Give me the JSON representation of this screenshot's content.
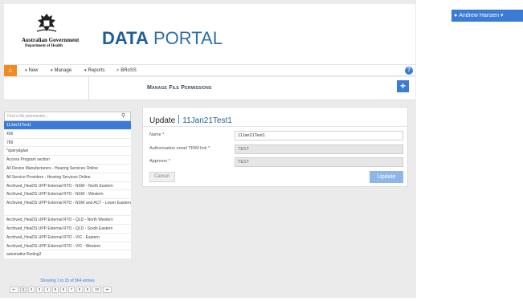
{
  "user": {
    "name": "Andrew Hansen",
    "icon": "user-icon",
    "caret": "▾"
  },
  "logo": {
    "gov_name": "Australian Government",
    "department": "Department of Health",
    "crest_icon": "coat-of-arms-icon"
  },
  "brand": {
    "part1": "DATA",
    "part2": "PORTAL"
  },
  "nav": {
    "home_icon": "home-icon",
    "items": [
      {
        "label": "New",
        "caret": "▾"
      },
      {
        "label": "Manage",
        "caret": "▾"
      },
      {
        "label": "Reports",
        "caret": "▾"
      },
      {
        "label": "BRoSS",
        "icon": "external-link-icon"
      }
    ],
    "help_icon": "question-circle-icon"
  },
  "subheader": {
    "title": "Manage File Permissions",
    "add_icon": "plus-icon"
  },
  "search": {
    "placeholder": "Find a file permission...",
    "icon": "search-icon"
  },
  "list": {
    "items": [
      "11Jan21Test1",
      "456",
      "789",
      "*query&glue",
      "Access Program section",
      "All Device Manufacturers - Hearing Services Online",
      "All Service Providers - Hearing Services Online",
      "Archived_HeaDS UPP External RTO - NSW - North Eastern",
      "Archived_HeaDS UPP External RTO - NSW - Western",
      "Archived_HeaDS UPP External RTO - NSW and ACT - Lower Eastern",
      "Archived_HeaDS UPP External RTO - QLD - North Western",
      "Archived_HeaDS UPP External RTO - QLD - South Eastern",
      "Archived_HeaDS UPP External RTO - VIC - Eastern",
      "Archived_HeaDS UPP External RTO - VIC - Western",
      "automationTesting2"
    ],
    "selected_index": 0
  },
  "pagination": {
    "info": "Showing 1 to 15 of 564 entries",
    "first": "⇤",
    "pages": [
      "1",
      "2",
      "3",
      "4",
      "5",
      "6",
      "7",
      "8",
      "9",
      "10"
    ],
    "next": "↦",
    "current": "1"
  },
  "form": {
    "heading": "Update",
    "record_name": "11Jan21Test1",
    "fields": [
      {
        "label": "Name *",
        "value": "11Jan21Test1",
        "readonly": false
      },
      {
        "label": "Authorisation email TRIM link *",
        "value": "TEST",
        "readonly": true
      },
      {
        "label": "Approver *",
        "value": "TEST",
        "readonly": true
      }
    ],
    "cancel_label": "Cancel",
    "update_label": "Update"
  },
  "colors": {
    "accent": "#3a7bd5",
    "home": "#f08a24",
    "brand": "#1f5f99",
    "update_disabled": "#8db7e8",
    "background": "#ebebeb"
  }
}
